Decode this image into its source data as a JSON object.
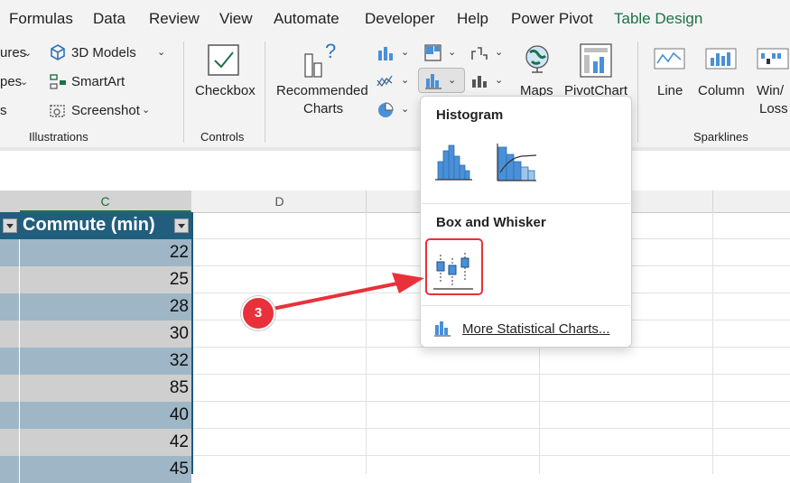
{
  "menu": {
    "tabs": [
      "Formulas",
      "Data",
      "Review",
      "View",
      "Automate",
      "Developer",
      "Help",
      "Power Pivot",
      "Table Design"
    ]
  },
  "ribbon": {
    "illustrations": {
      "pictures_partial": "ures",
      "shapes_partial": "pes",
      "icons_partial": "s",
      "models_label": "3D Models",
      "smartart_label": "SmartArt",
      "screenshot_label": "Screenshot",
      "group_label": "Illustrations"
    },
    "controls": {
      "checkbox_label": "Checkbox",
      "group_label": "Controls"
    },
    "charts": {
      "recommended_line1": "Recommended",
      "recommended_line2": "Charts",
      "maps_label": "Maps",
      "pivotchart_label": "PivotChart"
    },
    "sparklines": {
      "line_label": "Line",
      "column_label": "Column",
      "winloss_line1": "Win/",
      "winloss_line2": "Loss",
      "group_label": "Sparklines"
    }
  },
  "columns": {
    "c": "C",
    "d": "D"
  },
  "table": {
    "header": "Commute (min)",
    "values": [
      "22",
      "25",
      "28",
      "30",
      "32",
      "85",
      "40",
      "42",
      "45"
    ]
  },
  "dropdown": {
    "histogram_heading": "Histogram",
    "boxwhisker_heading": "Box and Whisker",
    "more_link": "More Statistical Charts..."
  },
  "annotation": {
    "step": "3"
  },
  "colors": {
    "accent_green": "#1e7145",
    "table_header": "#215e7e",
    "highlight_red": "#e8313a",
    "chart_blue": "#4a90d9"
  }
}
